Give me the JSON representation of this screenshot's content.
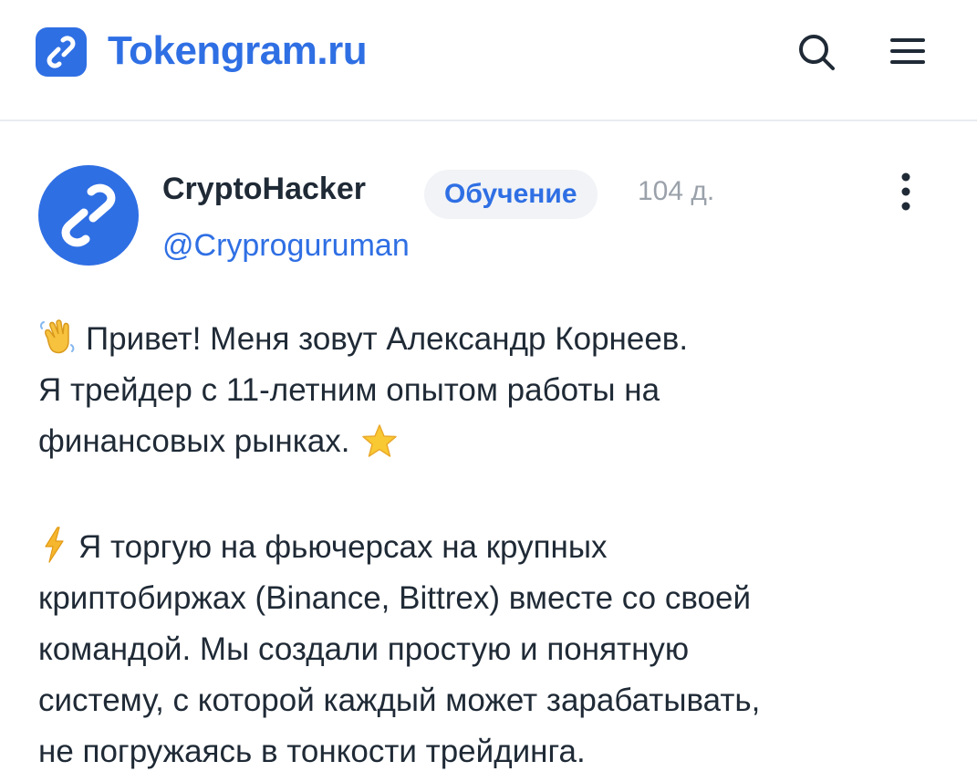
{
  "header": {
    "brand": "Tokengram.ru",
    "brand_color": "#2f6fe4",
    "icons": [
      "link-logo-icon",
      "search-icon",
      "hamburger-menu-icon"
    ]
  },
  "post": {
    "author": "CryptoHacker",
    "handle": "@Cryproguruman",
    "tag": "Обучение",
    "age": "104 д.",
    "more_icon": "kebab-menu-icon",
    "paragraph1": {
      "emoji_start": "waving-hand-icon",
      "lines": [
        "Привет! Меня зовут Александр Корнеев.",
        "Я трейдер с 11-летним опытом работы на",
        "финансовых рынках."
      ],
      "emoji_end": "star-icon"
    },
    "paragraph2": {
      "emoji_start": "lightning-icon",
      "lines": [
        "Я торгую на фьючерсах на крупных",
        "криптобиржах (Binance, Bittrex) вместе со своей",
        "командой. Мы создали простую и понятную",
        "систему, с которой каждый может зарабатывать,",
        "не погружаясь в тонкости трейдинга."
      ]
    }
  }
}
